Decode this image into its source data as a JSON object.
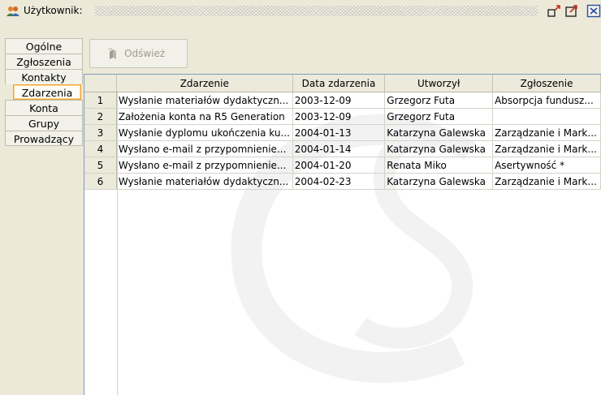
{
  "window": {
    "title": "Użytkownik:",
    "accent": "#f0a13a"
  },
  "titlebar_buttons": [
    {
      "name": "restore-icon"
    },
    {
      "name": "maximize-icon"
    },
    {
      "name": "close-icon"
    }
  ],
  "tabs": [
    {
      "label": "Ogólne",
      "active": false
    },
    {
      "label": "Zgłoszenia",
      "active": false
    },
    {
      "label": "Kontakty",
      "active": false
    },
    {
      "label": "Zdarzenia",
      "active": true
    },
    {
      "label": "Konta",
      "active": false
    },
    {
      "label": "Grupy",
      "active": false
    },
    {
      "label": "Prowadzący",
      "active": false
    }
  ],
  "toolbar": {
    "refresh_label": "Odśwież",
    "refresh_icon": "refresh-icon",
    "refresh_enabled": false
  },
  "table": {
    "columns": [
      "Zdarzenie",
      "Data zdarzenia",
      "Utworzył",
      "Zgłoszenie"
    ],
    "rows": [
      {
        "num": "1",
        "cells": [
          "Wysłanie materiałów dydaktyczn...",
          "2003-12-09",
          "Grzegorz Futa",
          "Absorpcja fundusz..."
        ]
      },
      {
        "num": "2",
        "cells": [
          "Założenia konta na R5 Generation",
          "2003-12-09",
          "Grzegorz Futa",
          ""
        ]
      },
      {
        "num": "3",
        "cells": [
          "Wysłanie dyplomu ukończenia ku...",
          "2004-01-13",
          "Katarzyna Galewska",
          "Zarządzanie i Mark..."
        ]
      },
      {
        "num": "4",
        "cells": [
          "Wysłano e-mail z przypomnienie...",
          "2004-01-14",
          "Katarzyna Galewska",
          "Zarządzanie i Mark..."
        ]
      },
      {
        "num": "5",
        "cells": [
          "Wysłano e-mail z przypomnienie...",
          "2004-01-20",
          "Renata Miko",
          "Asertywność *"
        ]
      },
      {
        "num": "6",
        "cells": [
          "Wysłanie materiałów dydaktyczn...",
          "2004-02-23",
          "Katarzyna Galewska",
          "Zarządzanie i Mark..."
        ]
      }
    ]
  }
}
